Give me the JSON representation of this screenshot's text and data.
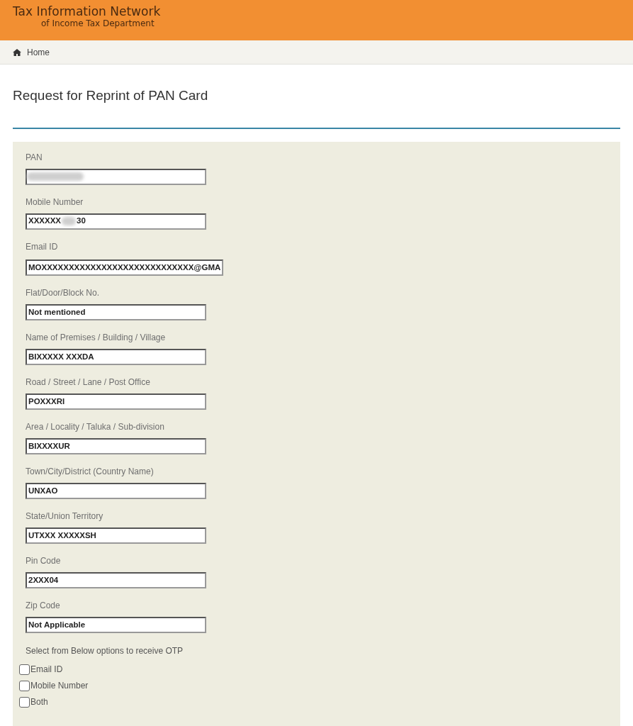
{
  "header": {
    "title": "Tax Information Network",
    "subtitle": "of Income Tax Department"
  },
  "breadcrumb": {
    "label": "Home"
  },
  "page_title": "Request for Reprint of PAN Card",
  "fields": [
    {
      "label": "PAN",
      "redacted": true
    },
    {
      "label": "Mobile Number",
      "value": "XXXXXX",
      "redacted": true,
      "value_end": "30"
    },
    {
      "label": "Email ID",
      "value": "MOXXXXXXXXXXXXXXXXXXXXXXXXXXXX@GMA"
    },
    {
      "label": "Flat/Door/Block No.",
      "value": "Not mentioned"
    },
    {
      "label": "Name of Premises / Building / Village",
      "value": "BIXXXXX XXXDA"
    },
    {
      "label": "Road / Street / Lane / Post Office",
      "value": "POXXXRI"
    },
    {
      "label": "Area / Locality / Taluka / Sub-division",
      "value": "BIXXXXUR"
    },
    {
      "label": "Town/City/District (Country Name)",
      "value": "UNXAO"
    },
    {
      "label": "State/Union Territory",
      "value": "UTXXX XXXXXSH"
    },
    {
      "label": "Pin Code",
      "value": "2XXX04"
    },
    {
      "label": "Zip Code",
      "value": "Not Applicable"
    }
  ],
  "otp": {
    "prompt": "Select from Below options to receive OTP",
    "options": [
      {
        "label": "Email ID",
        "checked": false
      },
      {
        "label": "Mobile Number",
        "checked": false
      },
      {
        "label": "Both",
        "checked": false
      }
    ]
  }
}
